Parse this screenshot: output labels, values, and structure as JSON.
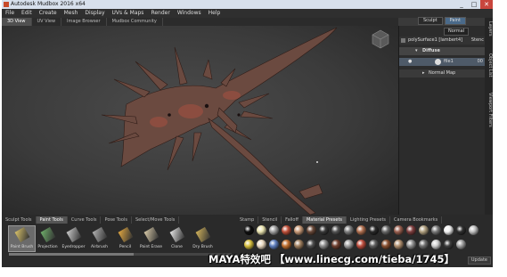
{
  "window": {
    "title": "Autodesk Mudbox 2016 x64",
    "minimize": "_",
    "maximize": "□",
    "close": "✕"
  },
  "menu": [
    "File",
    "Edit",
    "Create",
    "Mesh",
    "Display",
    "UVs & Maps",
    "Render",
    "Windows",
    "Help"
  ],
  "mode_tabs": [
    {
      "label": "Sculpt",
      "active": false
    },
    {
      "label": "Paint",
      "active": true
    }
  ],
  "view_tabs": [
    {
      "label": "3D View",
      "active": true
    },
    {
      "label": "UV View",
      "active": false
    },
    {
      "label": "Image Browser",
      "active": false
    },
    {
      "label": "Mudbox Community",
      "active": false
    }
  ],
  "layers": {
    "object": "polySurface1 [lambert4]",
    "mode": "Normal",
    "extra": "Stenc",
    "diffuse": "Diffuse",
    "layer": "file1",
    "opacity": "00",
    "normal_map": "Normal Map"
  },
  "side_tabs": [
    "Layers",
    "Object List",
    "Viewport Filters"
  ],
  "tool_tabs": [
    {
      "label": "Sculpt Tools",
      "active": false
    },
    {
      "label": "Paint Tools",
      "active": true
    },
    {
      "label": "Curve Tools",
      "active": false
    },
    {
      "label": "Pose Tools",
      "active": false
    },
    {
      "label": "Select/Move Tools",
      "active": false
    }
  ],
  "tools": [
    {
      "label": "Paint Brush",
      "icon": "paint-brush-icon",
      "active": true,
      "color": "#d9c26a"
    },
    {
      "label": "Projection",
      "icon": "projection-icon",
      "active": false,
      "color": "#6fae6a"
    },
    {
      "label": "Eyedropper",
      "icon": "eyedropper-icon",
      "active": false,
      "color": "#c9c9c9"
    },
    {
      "label": "Airbrush",
      "icon": "airbrush-icon",
      "active": false,
      "color": "#b0b0b0"
    },
    {
      "label": "Pencil",
      "icon": "pencil-icon",
      "active": false,
      "color": "#e0a640"
    },
    {
      "label": "Paint Erase",
      "icon": "paint-erase-icon",
      "active": false,
      "color": "#d8c9a8"
    },
    {
      "label": "Clone",
      "icon": "clone-icon",
      "active": false,
      "color": "#e6e6e6"
    },
    {
      "label": "Dry Brush",
      "icon": "dry-brush-icon",
      "active": false,
      "color": "#d1b25a"
    }
  ],
  "material_tabs": [
    {
      "label": "Stamp",
      "active": false
    },
    {
      "label": "Stencil",
      "active": false
    },
    {
      "label": "Falloff",
      "active": false
    },
    {
      "label": "Material Presets",
      "active": true
    },
    {
      "label": "Lighting Presets",
      "active": false
    },
    {
      "label": "Camera Bookmarks",
      "active": false
    }
  ],
  "materials_row1": [
    "#111111",
    "#e9e3b0",
    "#a0a0a0",
    "#c0503a",
    "#c89a78",
    "#6a4a3a",
    "#3a3a3a",
    "#555555",
    "#808080",
    "#b07050",
    "#2a2a2a",
    "#6a6a6a",
    "#9a6050",
    "#804040",
    "#b0a080",
    "#7a7a7a",
    "#f0f0f0",
    "#303030",
    "#c0c0c0"
  ],
  "materials_row2": [
    "#d8c040",
    "#e8d8c0",
    "#6080c0",
    "#c07030",
    "#a08060",
    "#505050",
    "#909090",
    "#704030",
    "#a0a0a0",
    "#c05040",
    "#606060",
    "#8a5030",
    "#b09070",
    "#909090",
    "#707070",
    "#d0d0d0",
    "#404040",
    "#a0a0a0"
  ],
  "update_button": "Update",
  "watermark": "MAYA特效吧 【www.linecg.com/tieba/1745】",
  "colors": {
    "accent": "#4a6a8a",
    "model": "#6b4a40"
  }
}
